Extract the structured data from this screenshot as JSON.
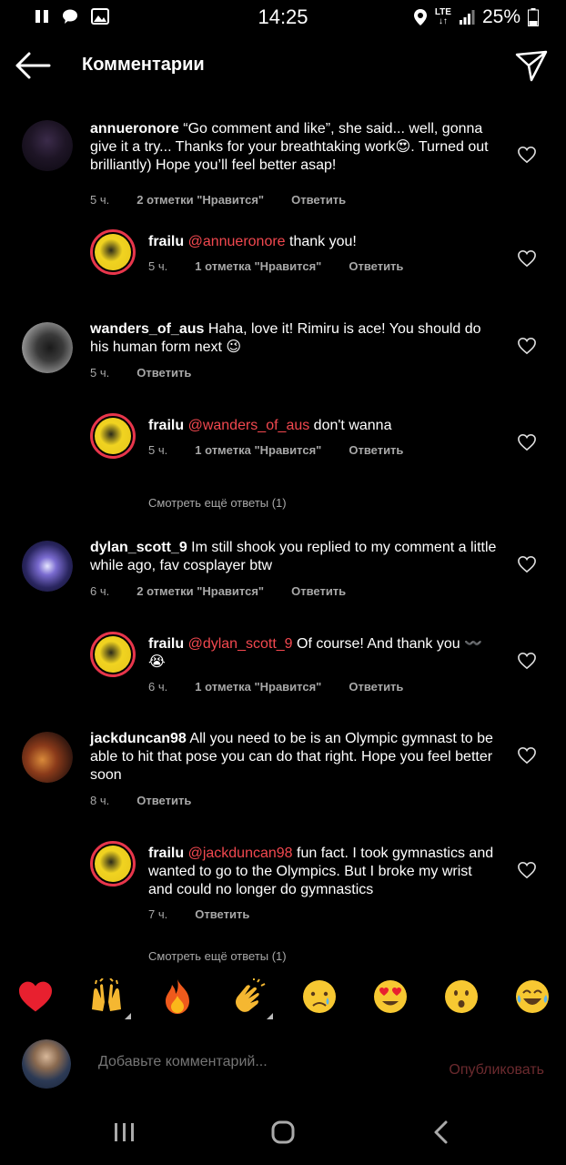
{
  "status_bar": {
    "time": "14:25",
    "network": "LTE",
    "battery": "25%"
  },
  "header": {
    "title": "Комментарии"
  },
  "comments": [
    {
      "username": "annueronore",
      "text": "“Go comment and like”, she said... well, gonna give it a try... Thanks for your breathtaking work😍. Turned out brilliantly) Hope you’ll feel better asap!",
      "time": "5 ч.",
      "likes": "2 отметки \"Нравится\"",
      "reply": "Ответить"
    },
    {
      "username": "frailu",
      "mention": "@annueronore",
      "text": " thank you!",
      "time": "5 ч.",
      "likes": "1 отметка \"Нравится\"",
      "reply": "Ответить"
    },
    {
      "username": "wanders_of_aus",
      "text": "Haha, love it! Rimiru is ace! You should do his human form next 😉",
      "time": "5 ч.",
      "reply": "Ответить"
    },
    {
      "username": "frailu",
      "mention": "@wanders_of_aus",
      "text": " don't wanna",
      "time": "5 ч.",
      "likes": "1 отметка \"Нравится\"",
      "reply": "Ответить"
    },
    {
      "username": "dylan_scott_9",
      "text": "Im still shook you replied to my comment a little while ago, fav cosplayer btw",
      "time": "6 ч.",
      "likes": "2 отметки \"Нравится\"",
      "reply": "Ответить"
    },
    {
      "username": "frailu",
      "mention": "@dylan_scott_9",
      "text": " Of course! And thank you 〰️ 😭",
      "time": "6 ч.",
      "likes": "1 отметка \"Нравится\"",
      "reply": "Ответить"
    },
    {
      "username": "jackduncan98",
      "text": "All you need to be is an Olympic gymnast to be able to hit that pose you can do that right. Hope you feel better soon",
      "time": "8 ч.",
      "reply": "Ответить"
    },
    {
      "username": "frailu",
      "mention": "@jackduncan98",
      "text": " fun fact. I took gymnastics and wanted to go to the Olympics. But I broke my wrist and could no longer do gymnastics",
      "time": "7 ч.",
      "reply": "Ответить"
    }
  ],
  "view_more_1": "Смотреть ещё ответы (1)",
  "view_more_2": "Смотреть ещё ответы (1)",
  "emoji_bar": [
    "❤️",
    "🙌",
    "🔥",
    "👏",
    "😢",
    "😍",
    "😮",
    "😂"
  ],
  "input": {
    "placeholder": "Добавьте комментарий...",
    "publish_label": "Опубликовать"
  },
  "colors": {
    "mention": "#f2484f",
    "story_ring": "#e8364b",
    "publish_disabled": "#6b2a2e"
  }
}
